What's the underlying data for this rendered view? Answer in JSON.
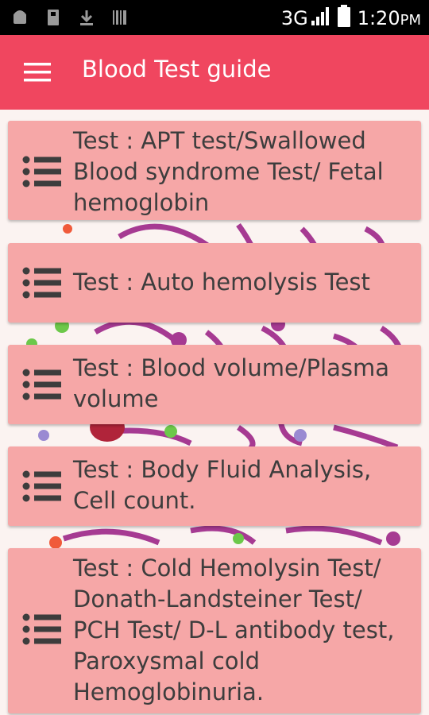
{
  "status_bar": {
    "network": "3G",
    "time": "1:20",
    "ampm": "PM",
    "icons": [
      "android-icon",
      "usb-icon",
      "download-icon",
      "barcode-icon",
      "signal-icon",
      "battery-icon"
    ]
  },
  "app_bar": {
    "title": "Blood Test guide",
    "menu_icon": "hamburger-menu-icon",
    "color": "#f0465f"
  },
  "tests": [
    {
      "label": "Test : APT test/Swallowed Blood syndrome Test/ Fetal hemoglobin",
      "icon": "list-icon"
    },
    {
      "label": "Test : Auto hemolysis Test",
      "icon": "list-icon"
    },
    {
      "label": "Test : Blood volume/Plasma volume",
      "icon": "list-icon"
    },
    {
      "label": "Test : Body Fluid Analysis, Cell count.",
      "icon": "list-icon"
    },
    {
      "label": "Test : Cold Hemolysin Test/ Donath-Landsteiner Test/ PCH Test/ D-L antibody test, Paroxysmal cold Hemoglobinuria.",
      "icon": "list-icon"
    }
  ],
  "colors": {
    "card": "#f6a7a7",
    "card_text": "#3d3d3d",
    "background": "#fbf3f1"
  }
}
